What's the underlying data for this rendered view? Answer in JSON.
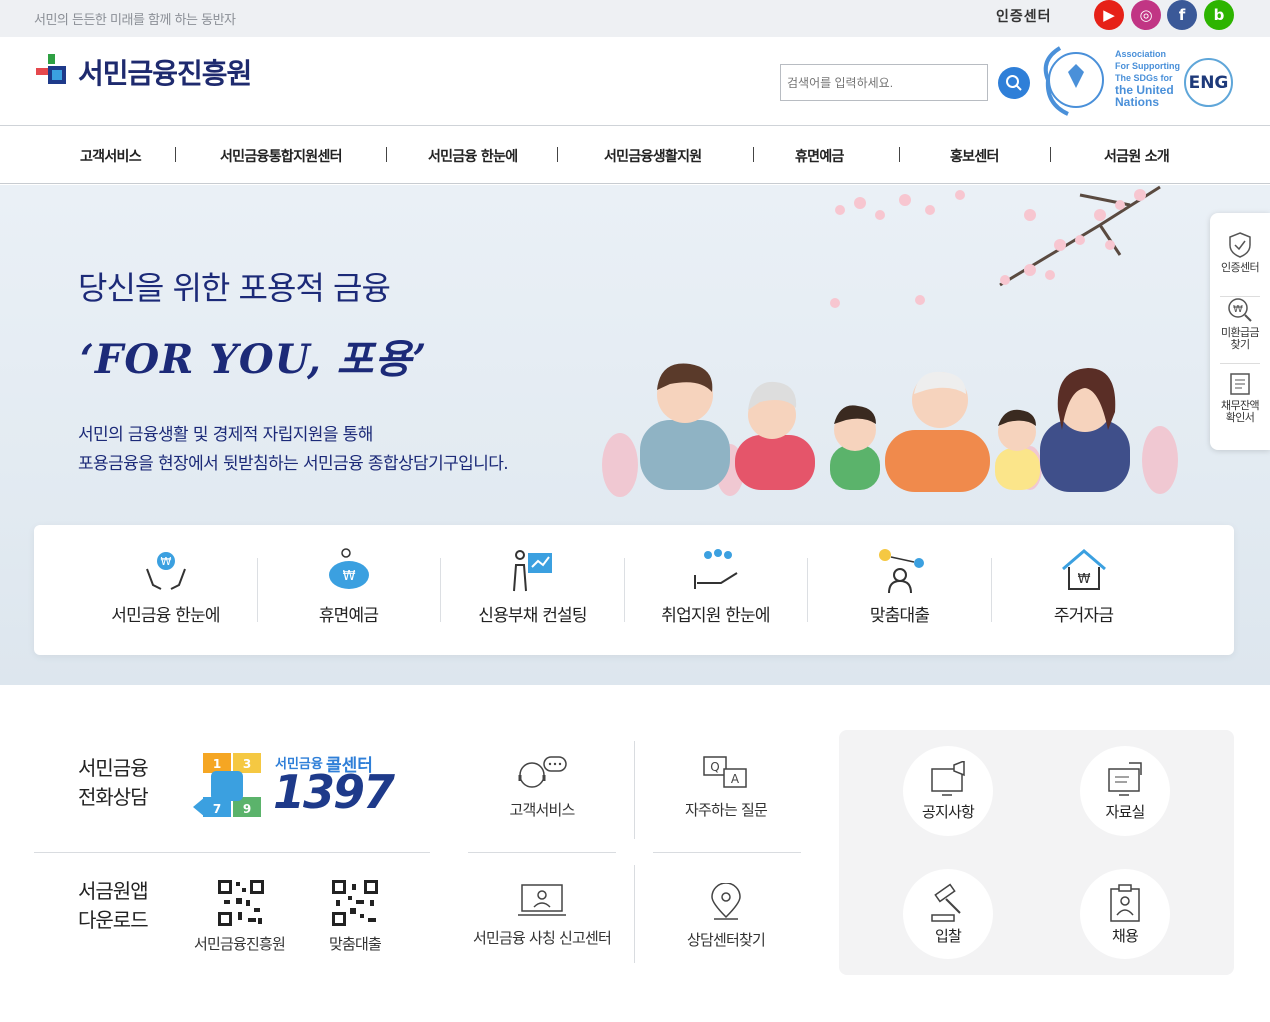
{
  "topbar": {
    "slogan": "서민의 든든한 미래를 함께 하는 동반자",
    "auth_link": "인증센터",
    "sns": [
      {
        "icon": "youtube-icon",
        "glyph": "▶",
        "color": "#e62117"
      },
      {
        "icon": "instagram-icon",
        "glyph": "◎",
        "color": "#c13584"
      },
      {
        "icon": "facebook-icon",
        "glyph": "f",
        "color": "#3b5998"
      },
      {
        "icon": "blog-icon",
        "glyph": "b",
        "color": "#2db400"
      }
    ]
  },
  "header": {
    "logo_text": "서민금융진흥원",
    "search_placeholder": "검색어를 입력하세요.",
    "sdg_circle_text": "Association for Supporting the SDGs for the UN",
    "sdg_text": [
      "Association",
      "For Supporting",
      "The SDGs for",
      "the United",
      "Nations"
    ],
    "eng_label": "ENG"
  },
  "gnb": {
    "items": [
      "고객서비스",
      "서민금융통합지원센터",
      "서민금융 한눈에",
      "서민금융생활지원",
      "휴면예금",
      "홍보센터",
      "서금원 소개"
    ]
  },
  "hero": {
    "subtitle": "당신을 위한 포용적 금융",
    "title": "‘FOR YOU, 포용’",
    "desc_line1": "서민의 금융생활 및 경제적 자립지원을 통해",
    "desc_line2": "포용금융을 현장에서 뒷받침하는 서민금융 종합상담기구입니다."
  },
  "quick": {
    "items": [
      {
        "label": "서민금융 한눈에",
        "icon": "hands-won-icon"
      },
      {
        "label": "휴면예금",
        "icon": "piggy-bank-icon"
      },
      {
        "label": "신용부채 컨설팅",
        "icon": "consulting-board-icon"
      },
      {
        "label": "취업지원 한눈에",
        "icon": "people-hand-icon"
      },
      {
        "label": "맞춤대출",
        "icon": "person-network-icon"
      },
      {
        "label": "주거자금",
        "icon": "house-won-icon"
      }
    ]
  },
  "side": {
    "items": [
      {
        "label": "인증센터",
        "icon": "shield-check-icon"
      },
      {
        "label": "미환급금 찾기",
        "icon": "won-search-icon"
      },
      {
        "label": "채무잔액 확인서",
        "icon": "document-icon"
      }
    ]
  },
  "bottom": {
    "call_title": "서민금융 전화상담",
    "call_center_small": "서민금융",
    "call_center_big": "콜센터",
    "call_number": "1397",
    "dial_digits": [
      "1",
      "3",
      "7",
      "9"
    ],
    "app_title": "서금원앱 다운로드",
    "apps": [
      "서민금융진흥원",
      "맞춤대출"
    ],
    "services": [
      {
        "label": "고객서비스",
        "icon": "headset-chat-icon"
      },
      {
        "label": "자주하는 질문",
        "icon": "qa-icon"
      },
      {
        "label": "서민금융 사칭 신고센터",
        "icon": "monitor-user-icon"
      },
      {
        "label": "상담센터찾기",
        "icon": "location-pin-icon"
      }
    ],
    "boards": [
      {
        "label": "공지사항",
        "icon": "megaphone-monitor-icon"
      },
      {
        "label": "자료실",
        "icon": "document-monitor-icon"
      },
      {
        "label": "입찰",
        "icon": "gavel-icon"
      },
      {
        "label": "채용",
        "icon": "id-clipboard-icon"
      }
    ]
  }
}
